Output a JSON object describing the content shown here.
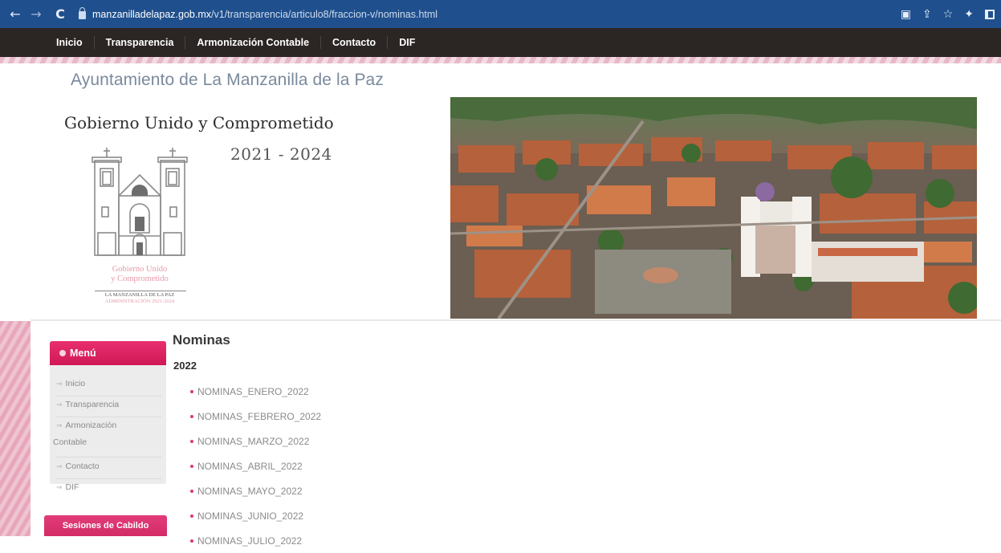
{
  "browser": {
    "url_host": "manzanilladelapaz.gob.mx",
    "url_path": "/v1/transparencia/articulo8/fraccion-v/nominas.html",
    "icons": [
      "translate-icon",
      "share-icon",
      "star-icon",
      "extensions-icon",
      "sidepanel-icon"
    ]
  },
  "site_nav": {
    "items": [
      "Inicio",
      "Transparencia",
      "Armonización Contable",
      "Contacto",
      "DIF"
    ]
  },
  "header": {
    "title": "Ayuntamiento de La Manzanilla de la Paz",
    "slogan": "Gobierno Unido y Comprometido",
    "period": "2021 - 2024",
    "logo_line1": "Gobierno Unido",
    "logo_line2": "y Comprometido",
    "logo_line3": "LA MANZANILLA DE LA PAZ",
    "logo_line4": "ADMINISTRACIÓN 2021-2024"
  },
  "sidebar": {
    "menu_title": "Menú",
    "items": [
      {
        "label": "Inicio"
      },
      {
        "label": "Transparencia"
      },
      {
        "label": "Armonización"
      },
      {
        "label": "Contable"
      },
      {
        "label": "Contacto"
      },
      {
        "label": "DIF"
      }
    ],
    "cabildo_label": "Sesiones de Cabildo"
  },
  "main": {
    "heading": "Nominas",
    "year": "2022",
    "documents": [
      "NOMINAS_ENERO_2022",
      "NOMINAS_FEBRERO_2022",
      "NOMINAS_MARZO_2022",
      "NOMINAS_ABRIL_2022",
      "NOMINAS_MAYO_2022",
      "NOMINAS_JUNIO_2022",
      "NOMINAS_JULIO_2022"
    ]
  },
  "colors": {
    "browser_bar": "#1f4f8c",
    "site_nav_bg": "#2b2524",
    "accent_pink": "#d11857",
    "bullet_pink": "#d93a6e"
  }
}
